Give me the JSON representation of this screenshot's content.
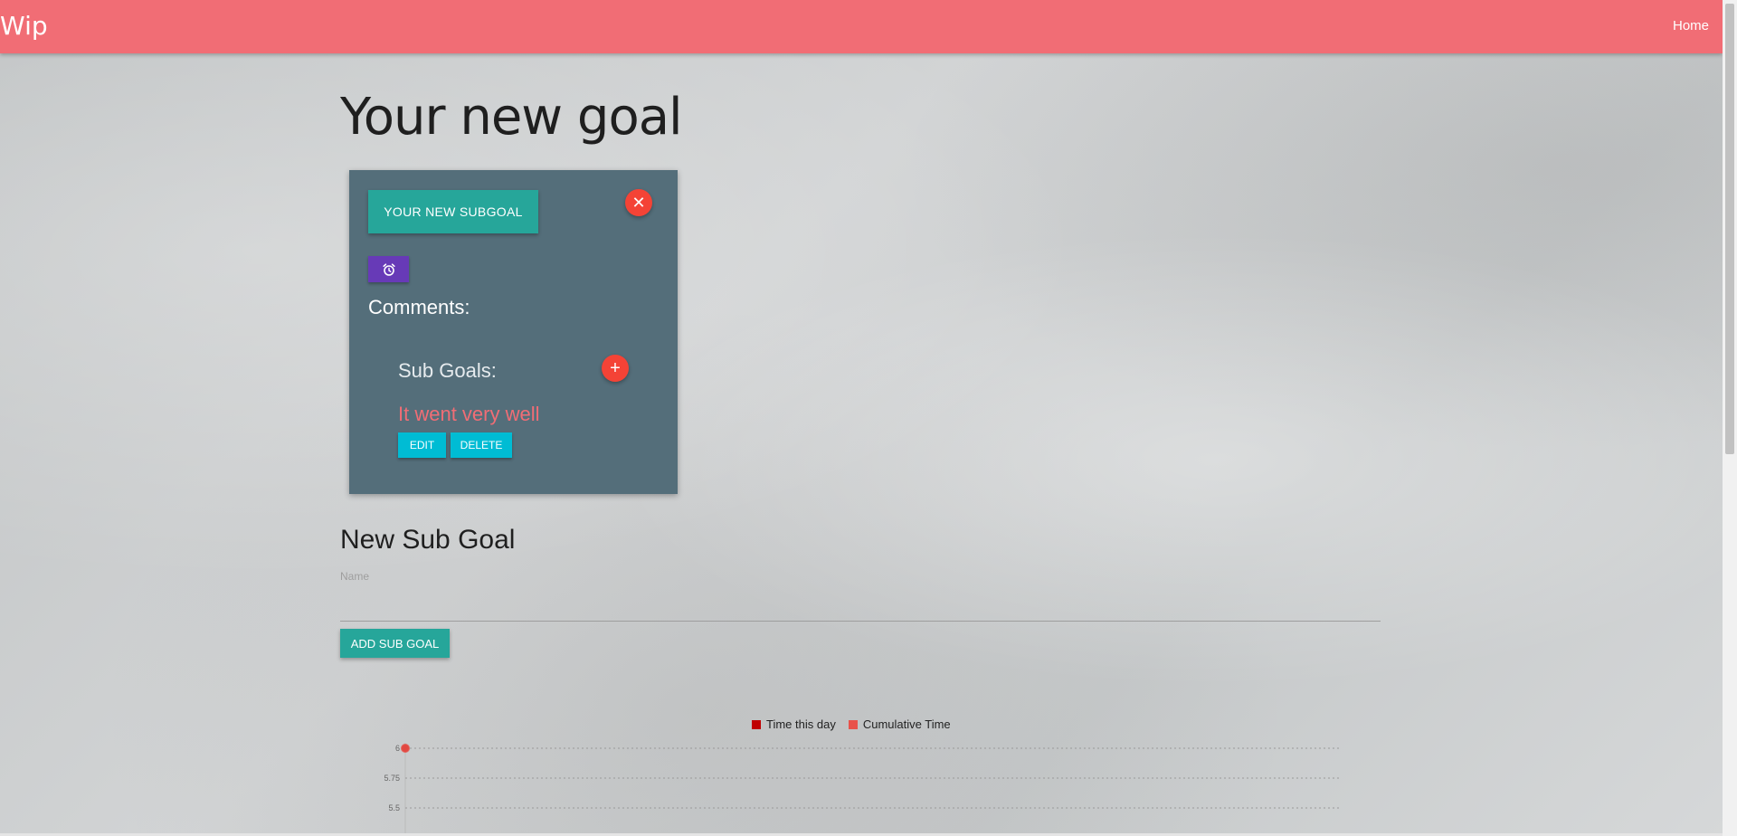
{
  "navbar": {
    "brand": "Wip",
    "home_link": "Home",
    "color": "#f16d75"
  },
  "page": {
    "title": "Your new goal"
  },
  "goal_card": {
    "subgoal_button": "YOUR NEW SUBGOAL",
    "close_icon": "close-icon",
    "alarm_icon": "alarm-clock-icon",
    "comments_label": "Comments:",
    "sub_goals_label": "Sub Goals:",
    "add_icon": "plus-icon",
    "comment_text": "It went very well",
    "edit_label": "EDIT",
    "delete_label": "DELETE",
    "background": "#546e7a"
  },
  "form": {
    "heading": "New Sub Goal",
    "name_placeholder": "Name",
    "name_value": "",
    "submit_label": "ADD SUB GOAL"
  },
  "chart_data": {
    "type": "line",
    "series": [
      {
        "name": "Time this day",
        "color": "#c00000",
        "values": [
          6
        ]
      },
      {
        "name": "Cumulative Time",
        "color": "#e8524a",
        "values": [
          6
        ]
      }
    ],
    "y_ticks": [
      "6",
      "5.75",
      "5.5"
    ],
    "grid": true,
    "legend": "top-center"
  }
}
